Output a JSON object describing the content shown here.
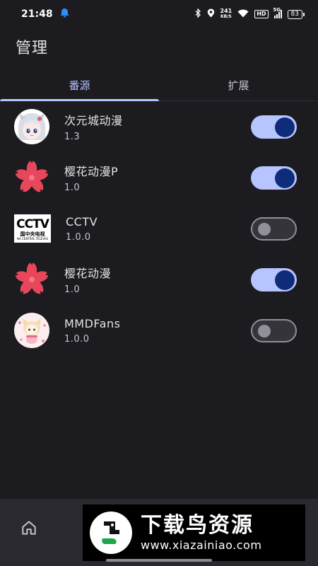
{
  "status_bar": {
    "time": "21:48",
    "net_speed_value": "241",
    "net_speed_unit": "KB/S",
    "hd_label": "HD",
    "signal_label": "5G",
    "battery": "83"
  },
  "header": {
    "title": "管理"
  },
  "tabs": [
    {
      "label": "番源",
      "active": true
    },
    {
      "label": "扩展",
      "active": false
    }
  ],
  "sources": [
    {
      "name": "次元城动漫",
      "version": "1.3",
      "enabled": true,
      "icon": "anime-girl-avatar"
    },
    {
      "name": "樱花动漫P",
      "version": "1.0",
      "enabled": true,
      "icon": "sakura-flower-icon"
    },
    {
      "name": "CCTV",
      "version": "1.0.0",
      "enabled": false,
      "icon": "cctv-logo",
      "logo_text": "CCTV",
      "logo_sub": "国中央电视",
      "logo_sub2": "NA CENTRAL TELEVISI"
    },
    {
      "name": "樱花动漫",
      "version": "1.0",
      "enabled": true,
      "icon": "sakura-flower-icon"
    },
    {
      "name": "MMDFans",
      "version": "1.0.0",
      "enabled": false,
      "icon": "chibi-avatar"
    }
  ],
  "bottom_nav": {
    "home_icon": "home-icon"
  },
  "watermark": {
    "title": "下载鸟资源",
    "url": "www.xiazainiao.com"
  },
  "colors": {
    "background": "#1c1b1f",
    "accent": "#b6c4ff",
    "switch_thumb_on": "#0e2c7a",
    "sakura": "#e8475b"
  }
}
